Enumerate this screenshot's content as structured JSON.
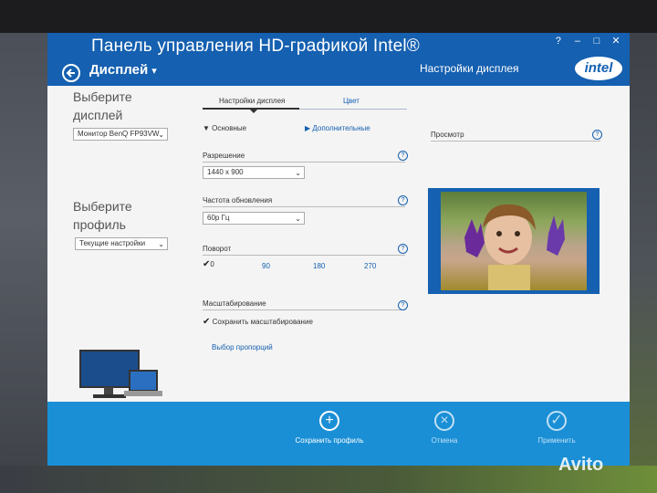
{
  "window": {
    "title": "Панель управления HD-графикой Intel®",
    "controls": [
      "?",
      "–",
      "□",
      "✕"
    ],
    "breadcrumb": "Дисплей",
    "right_title": "Настройки дисплея",
    "brand": "intel"
  },
  "sidebar": {
    "display_title": "Выберите дисплей",
    "display_value": "Монитор BenQ FP93VW",
    "profile_title": "Выберите профиль",
    "profile_value": "Текущие настройки"
  },
  "tabs": [
    {
      "label": "Настройки дисплея",
      "active": true
    },
    {
      "label": "Цвет",
      "active": false
    }
  ],
  "sections": {
    "basic": "Основные",
    "advanced": "Дополнительные"
  },
  "fields": {
    "resolution_label": "Разрешение",
    "resolution_value": "1440 x 900",
    "refresh_label": "Частота обновления",
    "refresh_value": "60р Гц",
    "rotation_label": "Поворот",
    "rotation_options": [
      "0",
      "90",
      "180",
      "270"
    ],
    "scaling_label": "Масштабирование",
    "scaling_check": "Сохранить масштабирование",
    "aspect_link": "Выбор пропорций",
    "help": "?"
  },
  "preview": {
    "label": "Просмотр"
  },
  "actions": {
    "save": "Сохранить профиль",
    "cancel": "Отмена",
    "apply": "Применить"
  },
  "watermark": "Avito",
  "colors": {
    "primary": "#1560b0",
    "bottombar": "#1a8fd6"
  }
}
